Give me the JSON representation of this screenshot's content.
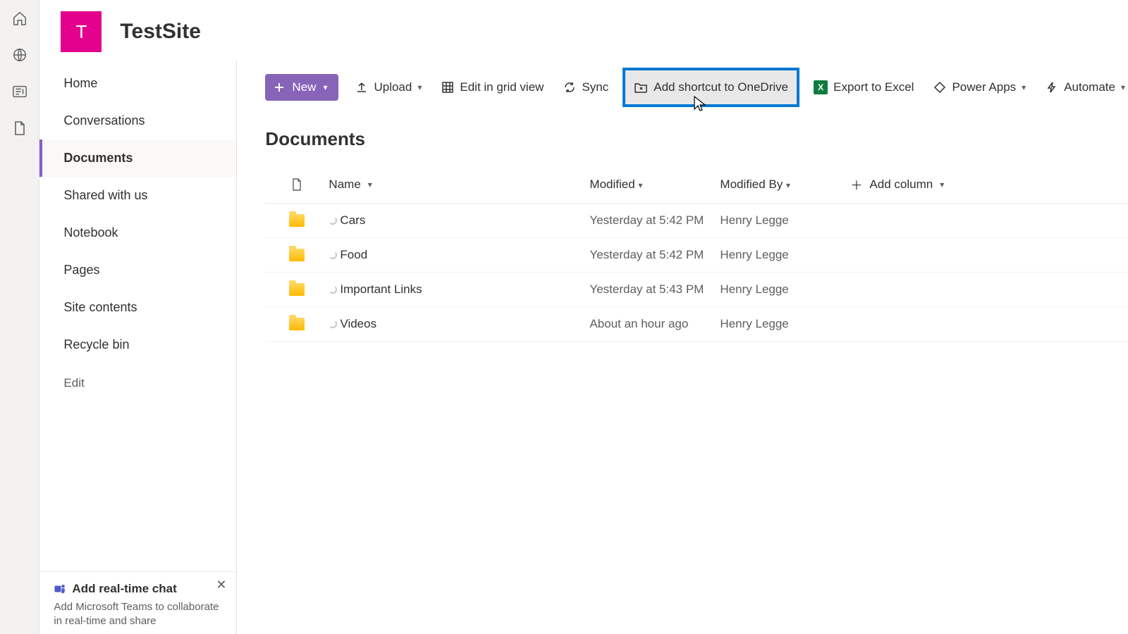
{
  "site": {
    "initial": "T",
    "title": "TestSite"
  },
  "nav": {
    "items": [
      {
        "label": "Home"
      },
      {
        "label": "Conversations"
      },
      {
        "label": "Documents",
        "active": true
      },
      {
        "label": "Shared with us"
      },
      {
        "label": "Notebook"
      },
      {
        "label": "Pages"
      },
      {
        "label": "Site contents"
      },
      {
        "label": "Recycle bin"
      }
    ],
    "edit": "Edit"
  },
  "toolbar": {
    "new": "New",
    "upload": "Upload",
    "edit_grid": "Edit in grid view",
    "sync": "Sync",
    "shortcut": "Add shortcut to OneDrive",
    "export": "Export to Excel",
    "powerapps": "Power Apps",
    "automate": "Automate"
  },
  "page": {
    "title": "Documents"
  },
  "columns": {
    "name": "Name",
    "modified": "Modified",
    "modifiedby": "Modified By",
    "add": "Add column"
  },
  "rows": [
    {
      "name": "Cars",
      "modified": "Yesterday at 5:42 PM",
      "by": "Henry Legge"
    },
    {
      "name": "Food",
      "modified": "Yesterday at 5:42 PM",
      "by": "Henry Legge"
    },
    {
      "name": "Important Links",
      "modified": "Yesterday at 5:43 PM",
      "by": "Henry Legge"
    },
    {
      "name": "Videos",
      "modified": "About an hour ago",
      "by": "Henry Legge"
    }
  ],
  "promo": {
    "title": "Add real-time chat",
    "text": "Add Microsoft Teams to collaborate in real-time and share"
  }
}
